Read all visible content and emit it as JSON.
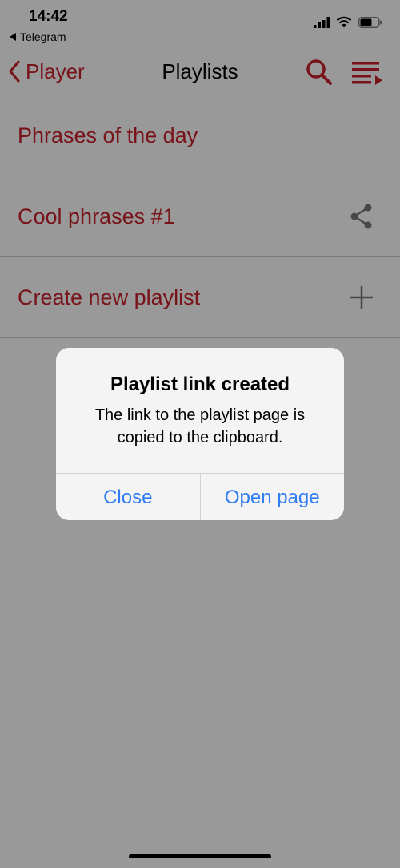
{
  "status_bar": {
    "time": "14:42",
    "back_app": "Telegram",
    "icons": [
      "cellular-signal-icon",
      "wifi-icon",
      "battery-icon"
    ]
  },
  "nav": {
    "back_label": "Player",
    "title": "Playlists",
    "icons": [
      "search-icon",
      "playlist-queue-icon"
    ]
  },
  "playlists": {
    "items": [
      {
        "label": "Phrases of the day",
        "icon": ""
      },
      {
        "label": "Cool phrases #1",
        "icon": "share-icon"
      },
      {
        "label": "Create new playlist",
        "icon": "plus-icon"
      }
    ]
  },
  "alert": {
    "title": "Playlist link created",
    "message": "The link to the playlist page is copied to the clipboard.",
    "close_label": "Close",
    "open_label": "Open page"
  },
  "colors": {
    "accent": "#c8202a",
    "link": "#2f7cf6",
    "background": "#ffffff",
    "overlay": "rgba(0,0,0,0.4)"
  }
}
